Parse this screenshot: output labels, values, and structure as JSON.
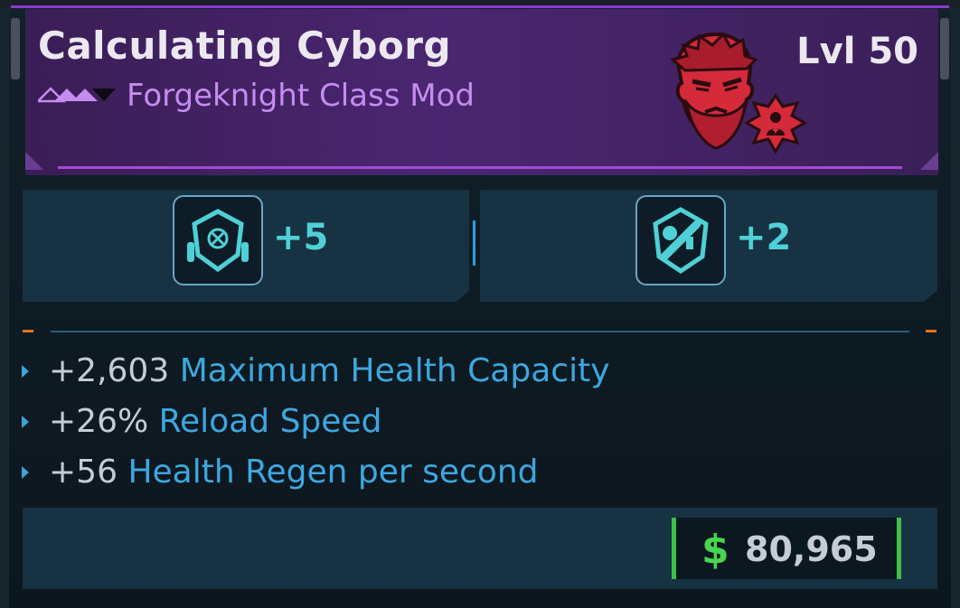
{
  "item": {
    "name": "Calculating Cyborg",
    "type": "Forgeknight Class Mod",
    "level": "Lvl 50",
    "rarity_icon": "rarity-triangles-icon",
    "portrait_icon": "bearded-cyborg-portrait-icon",
    "colors": {
      "header_bg": "#4a2670",
      "type_text": "#c58cf0",
      "accent_line": "#a34bd9",
      "portrait_red": "#d42a3a"
    }
  },
  "skills": [
    {
      "icon": "shield-ammo-skill-icon",
      "bonus": "+5"
    },
    {
      "icon": "shield-gun-skill-icon",
      "bonus": "+2"
    }
  ],
  "stats": [
    {
      "value": "+2,603",
      "label": "Maximum Health Capacity"
    },
    {
      "value": "+26%",
      "label": "Reload Speed"
    },
    {
      "value": "+56",
      "label": "Health Regen per second"
    }
  ],
  "price": {
    "currency_icon": "dollar-icon",
    "currency_symbol": "$",
    "amount": "80,965",
    "color": "#49d54f"
  }
}
